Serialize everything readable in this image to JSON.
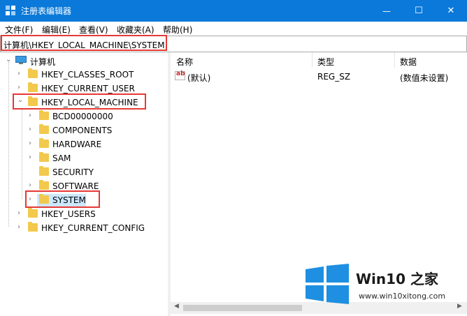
{
  "window": {
    "title": "注册表编辑器",
    "controls": {
      "minimize": "—",
      "maximize": "☐",
      "close": "✕"
    }
  },
  "menu": [
    "文件(F)",
    "编辑(E)",
    "查看(V)",
    "收藏夹(A)",
    "帮助(H)"
  ],
  "address": {
    "path": "计算机\\HKEY_LOCAL_MACHINE\\SYSTEM"
  },
  "tree": {
    "root": "计算机",
    "hives": [
      {
        "label": "HKEY_CLASSES_ROOT"
      },
      {
        "label": "HKEY_CURRENT_USER"
      },
      {
        "label": "HKEY_LOCAL_MACHINE",
        "expanded": true
      },
      {
        "label": "HKEY_USERS"
      },
      {
        "label": "HKEY_CURRENT_CONFIG"
      }
    ],
    "hklm_children": [
      "BCD00000000",
      "COMPONENTS",
      "HARDWARE",
      "SAM",
      "SECURITY",
      "SOFTWARE",
      "SYSTEM"
    ],
    "selected": "SYSTEM"
  },
  "values": {
    "columns": [
      "名称",
      "类型",
      "数据"
    ],
    "rows": [
      {
        "icon": "ab",
        "name": "(默认)",
        "type": "REG_SZ",
        "data": "(数值未设置)"
      }
    ]
  },
  "watermark": {
    "brand": "Win10 之家",
    "url": "www.win10xitong.com"
  },
  "colors": {
    "titlebar": "#0a79d9",
    "highlight": "#e53935",
    "folder": "#f2c94c",
    "selection": "#cce8ff",
    "logo_blue": "#1e8fe1"
  }
}
